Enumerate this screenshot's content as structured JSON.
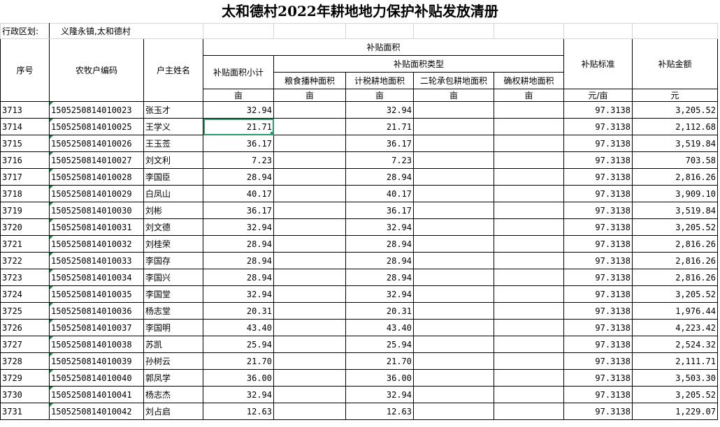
{
  "title": "太和德村2022年耕地地力保护补贴发放清册",
  "region": {
    "label": "行政区划:",
    "value": "义隆永镇,太和德村"
  },
  "headers": {
    "seq": "序号",
    "code": "农牧户编码",
    "name": "户主姓名",
    "area_group": "补贴面积",
    "area_total": "补贴面积小计",
    "area_type_group": "补贴面积类型",
    "grain": "粮食播种面积",
    "tax": "计税耕地面积",
    "contract": "二轮承包耕地面积",
    "confirmed": "确权耕地面积",
    "standard": "补贴标准",
    "amount": "补贴金额"
  },
  "units": {
    "area_total": "亩",
    "grain": "亩",
    "tax": "亩",
    "contract": "亩",
    "confirmed": "亩",
    "standard": "元/亩",
    "amount": "元"
  },
  "rows": [
    {
      "seq": "3713",
      "code": "1505250814010023",
      "name": "张玉才",
      "area": "32.94",
      "tax": "32.94",
      "standard": "97.3138",
      "amount": "3,205.52"
    },
    {
      "seq": "3714",
      "code": "1505250814010025",
      "name": "王学义",
      "area": "21.71",
      "tax": "21.71",
      "standard": "97.3138",
      "amount": "2,112.68"
    },
    {
      "seq": "3715",
      "code": "1505250814010026",
      "name": "王玉莶",
      "area": "36.17",
      "tax": "36.17",
      "standard": "97.3138",
      "amount": "3,519.84"
    },
    {
      "seq": "3716",
      "code": "1505250814010027",
      "name": "刘文利",
      "area": "7.23",
      "tax": "7.23",
      "standard": "97.3138",
      "amount": "703.58"
    },
    {
      "seq": "3717",
      "code": "1505250814010028",
      "name": "李国臣",
      "area": "28.94",
      "tax": "28.94",
      "standard": "97.3138",
      "amount": "2,816.26"
    },
    {
      "seq": "3718",
      "code": "1505250814010029",
      "name": "白凤山",
      "area": "40.17",
      "tax": "40.17",
      "standard": "97.3138",
      "amount": "3,909.10"
    },
    {
      "seq": "3719",
      "code": "1505250814010030",
      "name": "刘彬",
      "area": "36.17",
      "tax": "36.17",
      "standard": "97.3138",
      "amount": "3,519.84"
    },
    {
      "seq": "3720",
      "code": "1505250814010031",
      "name": "刘文德",
      "area": "32.94",
      "tax": "32.94",
      "standard": "97.3138",
      "amount": "3,205.52"
    },
    {
      "seq": "3721",
      "code": "1505250814010032",
      "name": "刘桂荣",
      "area": "28.94",
      "tax": "28.94",
      "standard": "97.3138",
      "amount": "2,816.26"
    },
    {
      "seq": "3722",
      "code": "1505250814010033",
      "name": "李国存",
      "area": "28.94",
      "tax": "28.94",
      "standard": "97.3138",
      "amount": "2,816.26"
    },
    {
      "seq": "3723",
      "code": "1505250814010034",
      "name": "李国兴",
      "area": "28.94",
      "tax": "28.94",
      "standard": "97.3138",
      "amount": "2,816.26"
    },
    {
      "seq": "3724",
      "code": "1505250814010035",
      "name": "李国堂",
      "area": "32.94",
      "tax": "32.94",
      "standard": "97.3138",
      "amount": "3,205.52"
    },
    {
      "seq": "3725",
      "code": "1505250814010036",
      "name": "杨志堂",
      "area": "20.31",
      "tax": "20.31",
      "standard": "97.3138",
      "amount": "1,976.44"
    },
    {
      "seq": "3726",
      "code": "1505250814010037",
      "name": "李国明",
      "area": "43.40",
      "tax": "43.40",
      "standard": "97.3138",
      "amount": "4,223.42"
    },
    {
      "seq": "3727",
      "code": "1505250814010038",
      "name": "苏凯",
      "area": "25.94",
      "tax": "25.94",
      "standard": "97.3138",
      "amount": "2,524.32"
    },
    {
      "seq": "3728",
      "code": "1505250814010039",
      "name": "孙树云",
      "area": "21.70",
      "tax": "21.70",
      "standard": "97.3138",
      "amount": "2,111.71"
    },
    {
      "seq": "3729",
      "code": "1505250814010040",
      "name": "郭凤学",
      "area": "36.00",
      "tax": "36.00",
      "standard": "97.3138",
      "amount": "3,503.30"
    },
    {
      "seq": "3730",
      "code": "1505250814010041",
      "name": "杨志杰",
      "area": "32.94",
      "tax": "32.94",
      "standard": "97.3138",
      "amount": "3,205.52"
    },
    {
      "seq": "3731",
      "code": "1505250814010042",
      "name": "刘占启",
      "area": "12.63",
      "tax": "12.63",
      "standard": "97.3138",
      "amount": "1,229.07"
    }
  ],
  "colors": {
    "selection": "#2a9a6a",
    "freeze_line": "#3aa675",
    "note_marker": "#1a8a3a"
  }
}
